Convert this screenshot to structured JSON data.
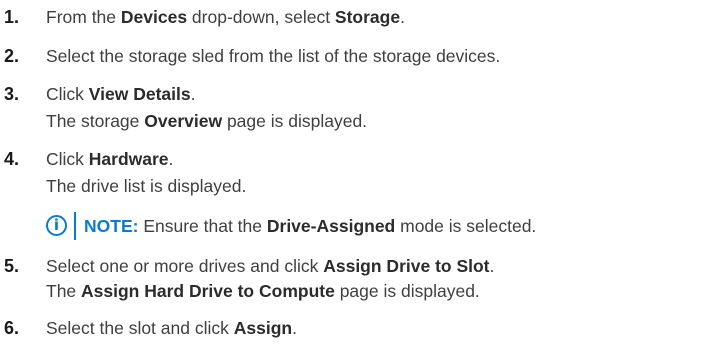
{
  "steps": [
    {
      "num": "1.",
      "a": "From the ",
      "b": "Devices",
      "c": " drop-down, select ",
      "d": "Storage",
      "e": "."
    },
    {
      "num": "2.",
      "text": "Select the storage sled from the list of the storage devices."
    },
    {
      "num": "3.",
      "a": "Click ",
      "b": "View Details",
      "c": ".",
      "r_a": "The storage ",
      "r_b": "Overview",
      "r_c": " page is displayed."
    },
    {
      "num": "4.",
      "a": "Click ",
      "b": "Hardware",
      "c": ".",
      "result": "The drive list is displayed."
    },
    {
      "num": "5.",
      "a": "Select one or more drives and click ",
      "b": "Assign Drive to Slot",
      "c": ".",
      "r_a": "The ",
      "r_b": "Assign Hard Drive to Compute",
      "r_c": " page is displayed."
    },
    {
      "num": "6.",
      "a": "Select the slot and click ",
      "b": "Assign",
      "c": "."
    }
  ],
  "note": {
    "icon": "info-icon",
    "icon_glyph": "i",
    "label": "NOTE:",
    "a": " Ensure that the ",
    "b": "Drive-Assigned",
    "c": " mode is selected."
  },
  "colors": {
    "accent": "#0a7ad4",
    "text": "#3f3f3f"
  }
}
